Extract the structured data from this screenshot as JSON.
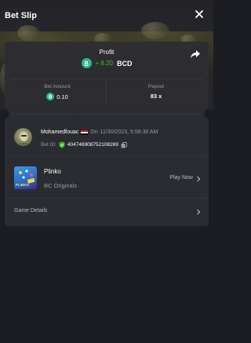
{
  "header": {
    "title": "Bet Slip"
  },
  "profit": {
    "label": "Profit",
    "value": "+ 8.20",
    "currency": "BCD"
  },
  "bet_amount": {
    "label": "Bet Amount",
    "value": "0.10"
  },
  "payout": {
    "label": "Payout",
    "value": "83 x"
  },
  "user": {
    "name": "Mohamedfouac",
    "on_label": "On",
    "datetime": "11/30/2023, 5:58:30 AM",
    "bet_id_label": "Bet ID:",
    "bet_id": "404746908752108269"
  },
  "game": {
    "name": "Plinko",
    "provider": "BC Originals",
    "play_label": "Play Now",
    "thumb_text": "PLINKO"
  },
  "details": {
    "label": "Game Details"
  },
  "colors": {
    "background": "#1c1d22",
    "card": "#2b2c31",
    "profit_green": "#3bc117",
    "coin_teal": "#2fb68a"
  },
  "icons": [
    "close-icon",
    "share-icon",
    "bcd-coin-icon",
    "verified-shield-icon",
    "copy-icon",
    "chevron-right-icon"
  ]
}
